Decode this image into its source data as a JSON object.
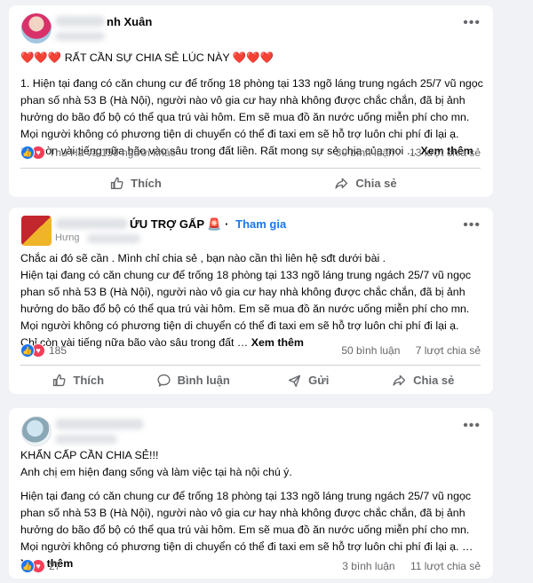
{
  "posts": [
    {
      "author": "nh Xuân",
      "body_lines": [
        "❤️❤️❤️ RẤT CẦN SỰ CHIA SẺ LÚC NÀY ❤️❤️❤️",
        "",
        "1. Hiện tại đang có căn chung cư để trống 18 phòng tại 133 ngõ láng trung ngách 25/7 vũ ngọc",
        "phan số nhà 53 B (Hà Nội), người nào vô gia cư hay nhà không được chắc chắn, đã bị ảnh",
        "hưởng do bão đổ bộ có thể qua trú vài hôm. Em sẽ mua đồ ăn nước uống miễn phí cho mn.",
        "Mọi người không có phương tiện di chuyển có thể đi taxi em sẽ hỗ trợ luôn chi phí đi lại ạ.",
        "Chỉ còn vài tiếng nữa bão vào sâu trong đất liền. Rất mong sự sẻ chia của mọi … "
      ],
      "see_more": "Xem thêm",
      "reactions": "Thu Hà và 159 người khác",
      "comments": "30 bình luận",
      "shares": "13 lượt chia sẻ",
      "actions": [
        "Thích",
        "Chia sẻ"
      ]
    },
    {
      "author": "ỨU TRỢ GẤP 🚨",
      "join": "Tham gia",
      "sub": "Hưng",
      "body_lines": [
        "Chắc ai đó sẽ cần . Mình chỉ chia sẻ  , bạn nào cần thì liên hệ sđt dưới bài .",
        "Hiện tại đang có căn chung cư để trống 18 phòng tại 133 ngõ láng trung ngách 25/7 vũ ngọc",
        "phan số nhà 53 B (Hà Nội), người nào vô gia cư hay nhà không được chắc chắn, đã bị ảnh",
        "hưởng do bão đổ bộ có thể qua trú vài hôm. Em sẽ mua đồ ăn nước uống miễn phí cho mn.",
        "Mọi người không có phương tiện di chuyển có thể đi taxi em sẽ hỗ trợ luôn chi phí đi lại ạ.",
        "Chỉ còn vài tiếng nữa bão vào sâu trong đất … "
      ],
      "see_more": "Xem thêm",
      "reactions": "185",
      "comments": "50 bình luận",
      "shares": "7 lượt chia sẻ",
      "actions": [
        "Thích",
        "Bình luận",
        "Gửi",
        "Chia sẻ"
      ]
    },
    {
      "body_lines": [
        "KHẨN CẤP CẦN CHIA SẺ!!!",
        "Anh chị em hiện đang sống và làm việc tại hà nội chú ý.",
        "",
        "Hiện tại đang có căn chung cư để trống 18 phòng tại 133 ngõ láng trung ngách 25/7 vũ ngọc",
        "phan số nhà 53 B (Hà Nội), người nào vô gia cư hay nhà không được chắc chắn, đã bị ảnh",
        "hưởng do bão đổ bộ có thể qua trú vài hôm. Em sẽ mua đồ ăn nước uống miễn phí cho mn.",
        "Mọi người không có phương tiện di chuyển có thể đi taxi em sẽ hỗ trợ luôn chi phí đi lại ạ. …"
      ],
      "see_more": "Xem thêm",
      "reactions": "27",
      "comments": "3 bình luận",
      "shares": "11 lượt chia sẻ"
    }
  ]
}
